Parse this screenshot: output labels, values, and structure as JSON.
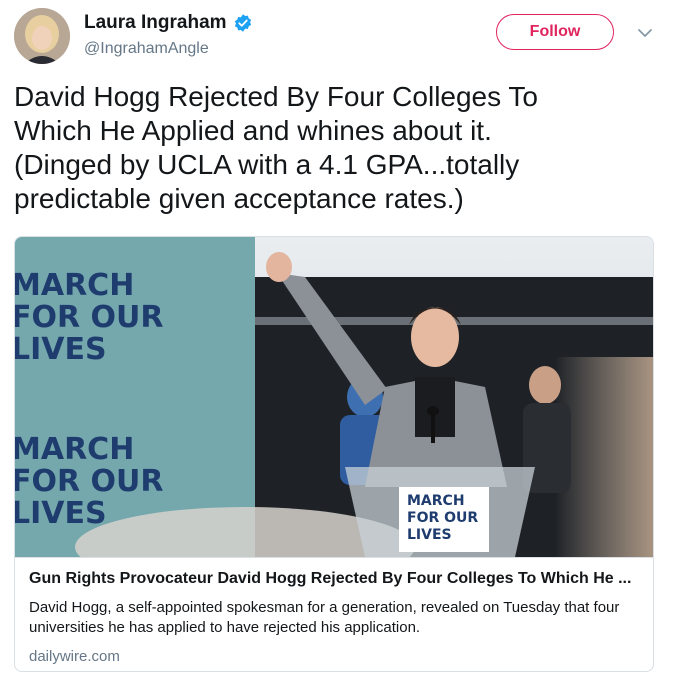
{
  "author": {
    "name": "Laura Ingraham",
    "handle": "@IngrahamAngle",
    "verified": true
  },
  "follow_button": {
    "label": "Follow"
  },
  "tweet": {
    "text": "David Hogg Rejected By Four Colleges To\nWhich He Applied and whines about it.\n(Dinged by UCLA with a 4.1 GPA...totally\npredictable given acceptance rates.)"
  },
  "link_card": {
    "title": "Gun Rights Provocateur David Hogg Rejected By Four Colleges To Which He ...",
    "description": "David Hogg, a self-appointed spokesman for a generation, revealed on Tuesday that four universities he has applied to have rejected his application.",
    "domain": "dailywire.com",
    "image": {
      "sign_lines": [
        "MARCH",
        "FOR OUR",
        "LIVES"
      ],
      "podium_sign_lines": [
        "MARCH",
        "FOR OUR",
        "LIVES"
      ]
    }
  },
  "colors": {
    "follow_accent": "#e0245e",
    "verified_badge": "#1da1f2",
    "muted_text": "#657786",
    "banner_teal": "#6fa3a8"
  },
  "icons": [
    "verified-badge-icon",
    "chevron-down-icon"
  ]
}
